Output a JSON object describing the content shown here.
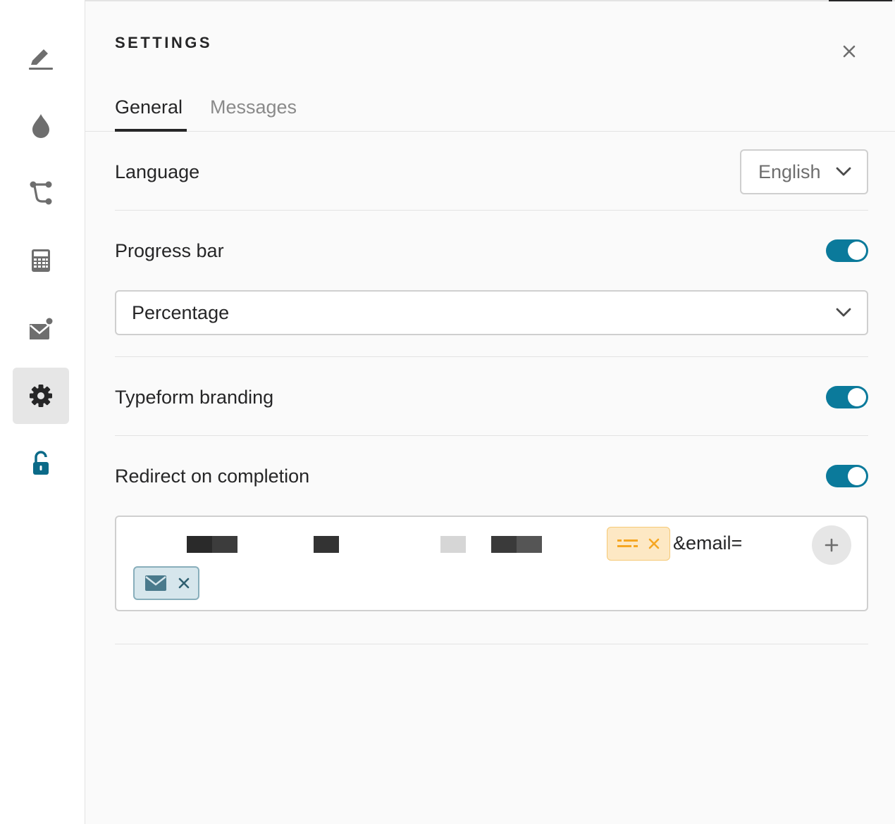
{
  "panel": {
    "title": "SETTINGS"
  },
  "tabs": [
    {
      "label": "General",
      "active": true
    },
    {
      "label": "Messages",
      "active": false
    }
  ],
  "language": {
    "label": "Language",
    "selected": "English"
  },
  "progress_bar": {
    "label": "Progress bar",
    "enabled": true,
    "selected": "Percentage"
  },
  "branding": {
    "label": "Typeform branding",
    "enabled": true
  },
  "redirect": {
    "label": "Redirect on completion",
    "enabled": true,
    "url_suffix": "&email="
  },
  "sidebar": {
    "items": [
      {
        "icon": "pen-icon"
      },
      {
        "icon": "drop-icon"
      },
      {
        "icon": "logic-branch-icon"
      },
      {
        "icon": "calculator-icon"
      },
      {
        "icon": "email-notification-icon"
      },
      {
        "icon": "gear-icon",
        "active": true
      },
      {
        "icon": "unlock-icon"
      }
    ]
  },
  "colors": {
    "accent": "#0b7a9b",
    "text": "#262627",
    "muted": "#8a8a8a",
    "divider": "#e3e3e3",
    "variable_chip": "#fde8c4",
    "email_chip": "#d6e6ec"
  }
}
